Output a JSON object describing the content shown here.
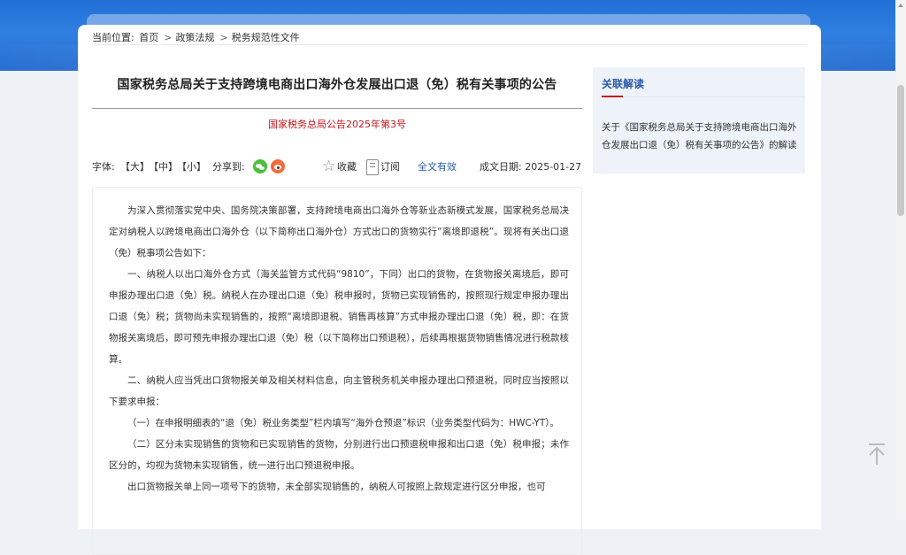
{
  "breadcrumb": {
    "label": "当前位置:",
    "home": "首页",
    "section": "政策法规",
    "current": "税务规范性文件",
    "separator": ">"
  },
  "article": {
    "title": "国家税务总局关于支持跨境电商出口海外仓发展出口退（免）税有关事项的公告",
    "doc_number": "国家税务总局公告2025年第3号"
  },
  "toolbar": {
    "font_size_label": "字体:",
    "font_large": "【大】",
    "font_mid": "【中】",
    "font_small": "【小】",
    "share_label": "分享到:",
    "favorite_label": "收藏",
    "subscribe_label": "订阅",
    "validity": "全文有效",
    "date_label": "成文日期:",
    "date": "2025-01-27",
    "icons": [
      "wechat-icon",
      "weibo-icon",
      "star-icon",
      "subscribe-icon"
    ]
  },
  "body": {
    "paragraphs": [
      "为深入贯彻落实党中央、国务院决策部署，支持跨境电商出口海外仓等新业态新模式发展，国家税务总局决定对纳税人以跨境电商出口海外仓（以下简称出口海外仓）方式出口的货物实行“离境即退税”。现将有关出口退（免）税事项公告如下：",
      "一、纳税人以出口海外仓方式（海关监管方式代码“9810”，下同）出口的货物，在货物报关离境后，即可申报办理出口退（免）税。纳税人在办理出口退（免）税申报时，货物已实现销售的，按照现行规定申报办理出口退（免）税；货物尚未实现销售的，按照“离境即退税、销售再核算”方式申报办理出口退（免）税，即：在货物报关离境后，即可预先申报办理出口退（免）税（以下简称出口预退税），后续再根据货物销售情况进行税款核算。",
      "二、纳税人应当凭出口货物报关单及相关材料信息，向主管税务机关申报办理出口预退税，同时应当按照以下要求申报：",
      "（一）在申报明细表的“退（免）税业务类型”栏内填写“海外仓预退”标识（业务类型代码为：HWC-YT）。",
      "（二）区分未实现销售的货物和已实现销售的货物，分别进行出口预退税申报和出口退（免）税申报；未作区分的，均视为货物未实现销售，统一进行出口预退税申报。",
      "出口货物报关单上同一项号下的货物，未全部实现销售的，纳税人可按照上款规定进行区分申报，也可"
    ]
  },
  "sidebar": {
    "title": "关联解读",
    "link": "关于《国家税务总局关于支持跨境电商出口海外仓发展出口退（免）税有关事项的公告》的解读"
  },
  "colors": {
    "header_blue": "#2f7fe0",
    "accent_red": "#c8161d",
    "link_blue": "#2b5aa8"
  }
}
